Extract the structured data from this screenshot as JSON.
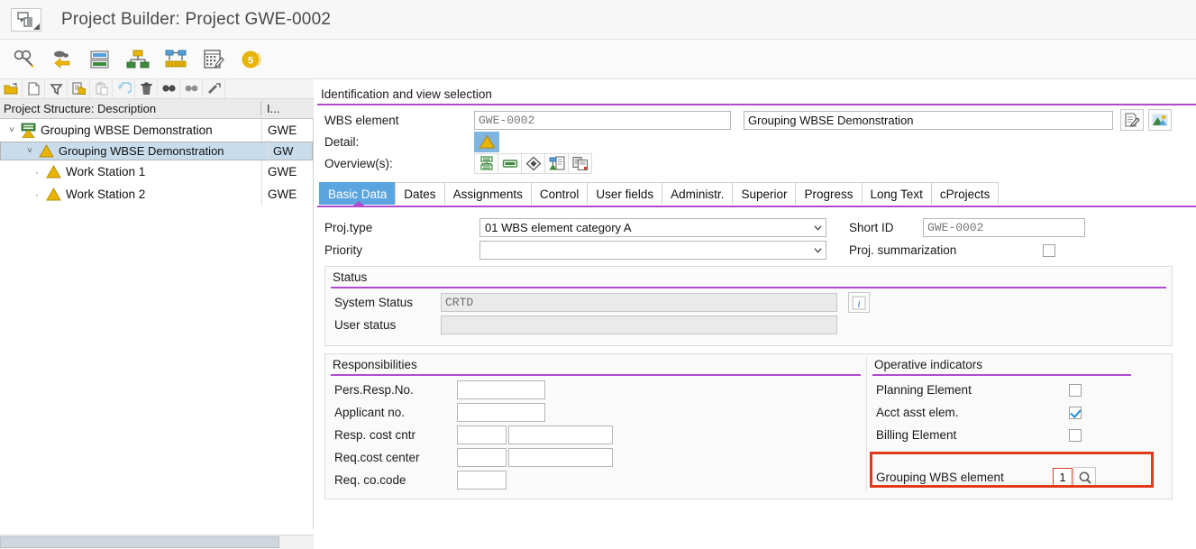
{
  "window": {
    "title": "Project Builder: Project GWE-0002",
    "title_icon": "project-builder-icon"
  },
  "app_toolbar": {
    "buttons": [
      {
        "name": "display-change-icon",
        "label": "Display <-> Change"
      },
      {
        "name": "previous-object-icon",
        "label": "Previous object"
      },
      {
        "name": "project-definition-icon",
        "label": "Project Definition"
      },
      {
        "name": "hierarchy-graphic-icon",
        "label": "Hierarchy Graphic"
      },
      {
        "name": "network-graphic-icon",
        "label": "Network Graphic"
      },
      {
        "name": "planning-board-icon",
        "label": "Project Planning Board"
      },
      {
        "name": "status-badge-icon",
        "label": "5"
      }
    ],
    "badge_value": "5"
  },
  "tree_toolbar": {
    "buttons": [
      {
        "name": "open-folder-icon",
        "label": "Open"
      },
      {
        "name": "new-document-icon",
        "label": "Create"
      },
      {
        "name": "filter-icon",
        "label": "Filter"
      },
      {
        "name": "copy-icon",
        "label": "Copy"
      },
      {
        "name": "paste-icon",
        "label": "Paste"
      },
      {
        "name": "undo-icon",
        "label": "Undo"
      },
      {
        "name": "delete-icon",
        "label": "Delete"
      },
      {
        "name": "find-icon",
        "label": "Find"
      },
      {
        "name": "find-next-icon",
        "label": "Find Next"
      },
      {
        "name": "more-actions-icon",
        "label": "More"
      }
    ]
  },
  "tree": {
    "columns": [
      "Project Structure: Description",
      "I..."
    ],
    "rows": [
      {
        "indent": 0,
        "twisty": "expanded",
        "icon": "project-definition-icon",
        "label": "Grouping WBSE Demonstration",
        "id": "GWE",
        "selected": false
      },
      {
        "indent": 1,
        "twisty": "expanded",
        "icon": "wbs-element-icon",
        "label": "Grouping WBSE Demonstration",
        "id": "GWE",
        "selected": true
      },
      {
        "indent": 2,
        "twisty": "leaf",
        "icon": "wbs-element-icon",
        "label": "Work Station 1",
        "id": "GWE",
        "selected": false
      },
      {
        "indent": 2,
        "twisty": "leaf",
        "icon": "wbs-element-icon",
        "label": "Work Station 2",
        "id": "GWE",
        "selected": false
      }
    ]
  },
  "identification": {
    "section_title": "Identification and view selection",
    "wbs_element_label": "WBS element",
    "wbs_element_value": "GWE-0002",
    "description_value": "Grouping WBSE Demonstration",
    "detail_label": "Detail:",
    "detail_icon": "wbs-element-detail-icon",
    "overviews_label": "Overview(s):",
    "overview_icons": [
      {
        "name": "wbs-overview-icon"
      },
      {
        "name": "activity-overview-icon"
      },
      {
        "name": "milestone-overview-icon"
      },
      {
        "name": "material-overview-icon"
      },
      {
        "name": "document-overview-icon"
      }
    ],
    "right_icons": [
      {
        "name": "long-text-edit-icon"
      },
      {
        "name": "graphic-view-icon"
      }
    ]
  },
  "tabs": {
    "items": [
      {
        "label": "Basic Data",
        "active": true
      },
      {
        "label": "Dates",
        "active": false
      },
      {
        "label": "Assignments",
        "active": false
      },
      {
        "label": "Control",
        "active": false
      },
      {
        "label": "User fields",
        "active": false
      },
      {
        "label": "Administr.",
        "active": false
      },
      {
        "label": "Superior",
        "active": false
      },
      {
        "label": "Progress",
        "active": false
      },
      {
        "label": "Long Text",
        "active": false
      },
      {
        "label": "cProjects",
        "active": false
      }
    ]
  },
  "basic_data": {
    "proj_type_label": "Proj.type",
    "proj_type_value": "01 WBS element category A",
    "proj_type_options": [
      "01 WBS element category A"
    ],
    "priority_label": "Priority",
    "priority_value": "",
    "priority_options": [],
    "short_id_label": "Short ID",
    "short_id_value": "GWE-0002",
    "proj_summarization_label": "Proj. summarization",
    "proj_summarization_checked": false
  },
  "status_section": {
    "title": "Status",
    "system_status_label": "System Status",
    "system_status_value": "CRTD",
    "user_status_label": "User status",
    "user_status_value": "",
    "info_icon": "info-icon"
  },
  "responsibilities": {
    "title": "Responsibilities",
    "fields": [
      {
        "label": "Pers.Resp.No.",
        "value": "",
        "extra": false
      },
      {
        "label": "Applicant no.",
        "value": "",
        "extra": false
      },
      {
        "label": "Resp. cost cntr",
        "value": "",
        "extra": true
      },
      {
        "label": "Req.cost center",
        "value": "",
        "extra": true
      },
      {
        "label": "Req. co.code",
        "value": "",
        "extra": false
      }
    ]
  },
  "operative_indicators": {
    "title": "Operative indicators",
    "items": [
      {
        "label": "Planning Element",
        "checked": false
      },
      {
        "label": "Acct asst elem.",
        "checked": true
      },
      {
        "label": "Billing Element",
        "checked": false
      }
    ],
    "grouping_wbs_label": "Grouping WBS element",
    "grouping_wbs_value": "1",
    "grouping_wbs_search_icon": "search-help-icon",
    "highlight_color": "#e03a18"
  },
  "colors": {
    "accent_purple": "#b04ad0",
    "tab_active_blue": "#5aa5e0",
    "tree_selection": "#c9dcec",
    "highlight_red": "#e03a18",
    "sap_yellow": "#e8b406"
  }
}
